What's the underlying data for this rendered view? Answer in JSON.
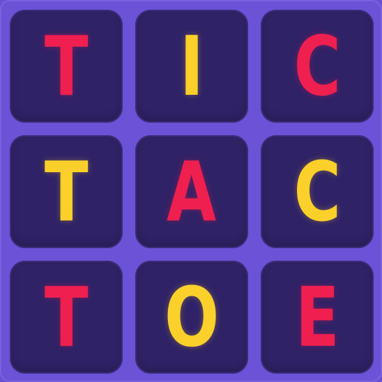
{
  "game": {
    "colors": {
      "board": "#6b52d6",
      "tile": "#2f2266",
      "red": "#ef1f4f",
      "yellow": "#fbd02a"
    },
    "tiles": [
      {
        "letter": "T",
        "color": "#ef1f4f"
      },
      {
        "letter": "I",
        "color": "#fbd02a"
      },
      {
        "letter": "C",
        "color": "#ef1f4f"
      },
      {
        "letter": "T",
        "color": "#fbd02a"
      },
      {
        "letter": "A",
        "color": "#ef1f4f"
      },
      {
        "letter": "C",
        "color": "#fbd02a"
      },
      {
        "letter": "T",
        "color": "#ef1f4f"
      },
      {
        "letter": "O",
        "color": "#fbd02a"
      },
      {
        "letter": "E",
        "color": "#ef1f4f"
      }
    ]
  }
}
